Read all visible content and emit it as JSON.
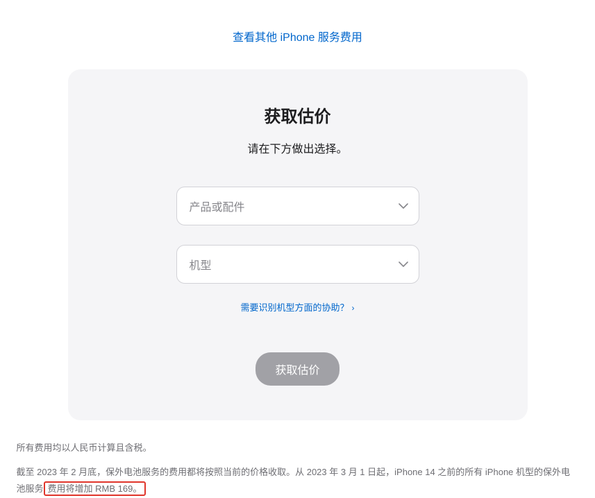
{
  "topLink": {
    "text": "查看其他 iPhone 服务费用"
  },
  "card": {
    "title": "获取估价",
    "subtitle": "请在下方做出选择。",
    "select1": {
      "placeholder": "产品或配件"
    },
    "select2": {
      "placeholder": "机型"
    },
    "helpLink": {
      "text": "需要识别机型方面的协助？",
      "arrow": "›"
    },
    "submitLabel": "获取估价"
  },
  "footnotes": {
    "line1": "所有费用均以人民币计算且含税。",
    "line2_pre": "截至 2023 年 2 月底，保外电池服务的费用都将按照当前的价格收取。从 2023 年 3 月 1 日起，iPhone 14 之前的所有 iPhone 机型的保外电池服务",
    "line2_highlight": "费用将增加 RMB 169。"
  }
}
